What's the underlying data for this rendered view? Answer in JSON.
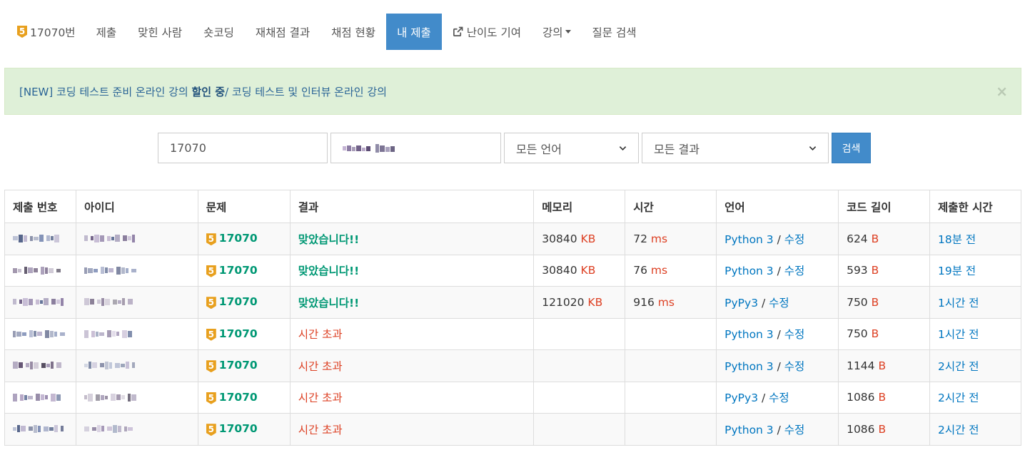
{
  "nav": {
    "problem_tier": "5",
    "problem_label": "17070번",
    "items": [
      "제출",
      "맞힌 사람",
      "숏코딩",
      "재채점 결과",
      "채점 현황",
      "내 제출",
      "난이도 기여",
      "강의",
      "질문 검색"
    ]
  },
  "alert": {
    "prefix": "[NEW] 코딩 테스트 준비 온라인 강의 ",
    "bold": "할인 중",
    "suffix": " / 코딩 테스트 및 인터뷰 온라인 강의",
    "close": "×"
  },
  "search": {
    "problem_id": "17070",
    "language": "모든 언어",
    "result": "모든 결과",
    "button": "검색"
  },
  "table": {
    "headers": [
      "제출 번호",
      "아이디",
      "문제",
      "결과",
      "메모리",
      "시간",
      "언어",
      "코드 길이",
      "제출한 시간"
    ],
    "rows": [
      {
        "problem": "17070",
        "tier": "5",
        "result": "맞았습니다!!",
        "ok": true,
        "memory": "30840",
        "mem_unit": "KB",
        "time": "72",
        "time_unit": "ms",
        "lang": "Python 3",
        "edit": "수정",
        "length": "624",
        "len_unit": "B",
        "submitted": "18분 전"
      },
      {
        "problem": "17070",
        "tier": "5",
        "result": "맞았습니다!!",
        "ok": true,
        "memory": "30840",
        "mem_unit": "KB",
        "time": "76",
        "time_unit": "ms",
        "lang": "Python 3",
        "edit": "수정",
        "length": "593",
        "len_unit": "B",
        "submitted": "19분 전"
      },
      {
        "problem": "17070",
        "tier": "5",
        "result": "맞았습니다!!",
        "ok": true,
        "memory": "121020",
        "mem_unit": "KB",
        "time": "916",
        "time_unit": "ms",
        "lang": "PyPy3",
        "edit": "수정",
        "length": "750",
        "len_unit": "B",
        "submitted": "1시간 전"
      },
      {
        "problem": "17070",
        "tier": "5",
        "result": "시간 초과",
        "ok": false,
        "memory": "",
        "mem_unit": "",
        "time": "",
        "time_unit": "",
        "lang": "Python 3",
        "edit": "수정",
        "length": "750",
        "len_unit": "B",
        "submitted": "1시간 전"
      },
      {
        "problem": "17070",
        "tier": "5",
        "result": "시간 초과",
        "ok": false,
        "memory": "",
        "mem_unit": "",
        "time": "",
        "time_unit": "",
        "lang": "Python 3",
        "edit": "수정",
        "length": "1144",
        "len_unit": "B",
        "submitted": "2시간 전"
      },
      {
        "problem": "17070",
        "tier": "5",
        "result": "시간 초과",
        "ok": false,
        "memory": "",
        "mem_unit": "",
        "time": "",
        "time_unit": "",
        "lang": "PyPy3",
        "edit": "수정",
        "length": "1086",
        "len_unit": "B",
        "submitted": "2시간 전"
      },
      {
        "problem": "17070",
        "tier": "5",
        "result": "시간 초과",
        "ok": false,
        "memory": "",
        "mem_unit": "",
        "time": "",
        "time_unit": "",
        "lang": "Python 3",
        "edit": "수정",
        "length": "1086",
        "len_unit": "B",
        "submitted": "2시간 전"
      }
    ]
  },
  "colors": {
    "primary": "#428bca",
    "accepted": "#009874",
    "error": "#dd4124",
    "link": "#0076c0",
    "tier": "#e8a01e",
    "alert_bg": "#dff0d8"
  }
}
